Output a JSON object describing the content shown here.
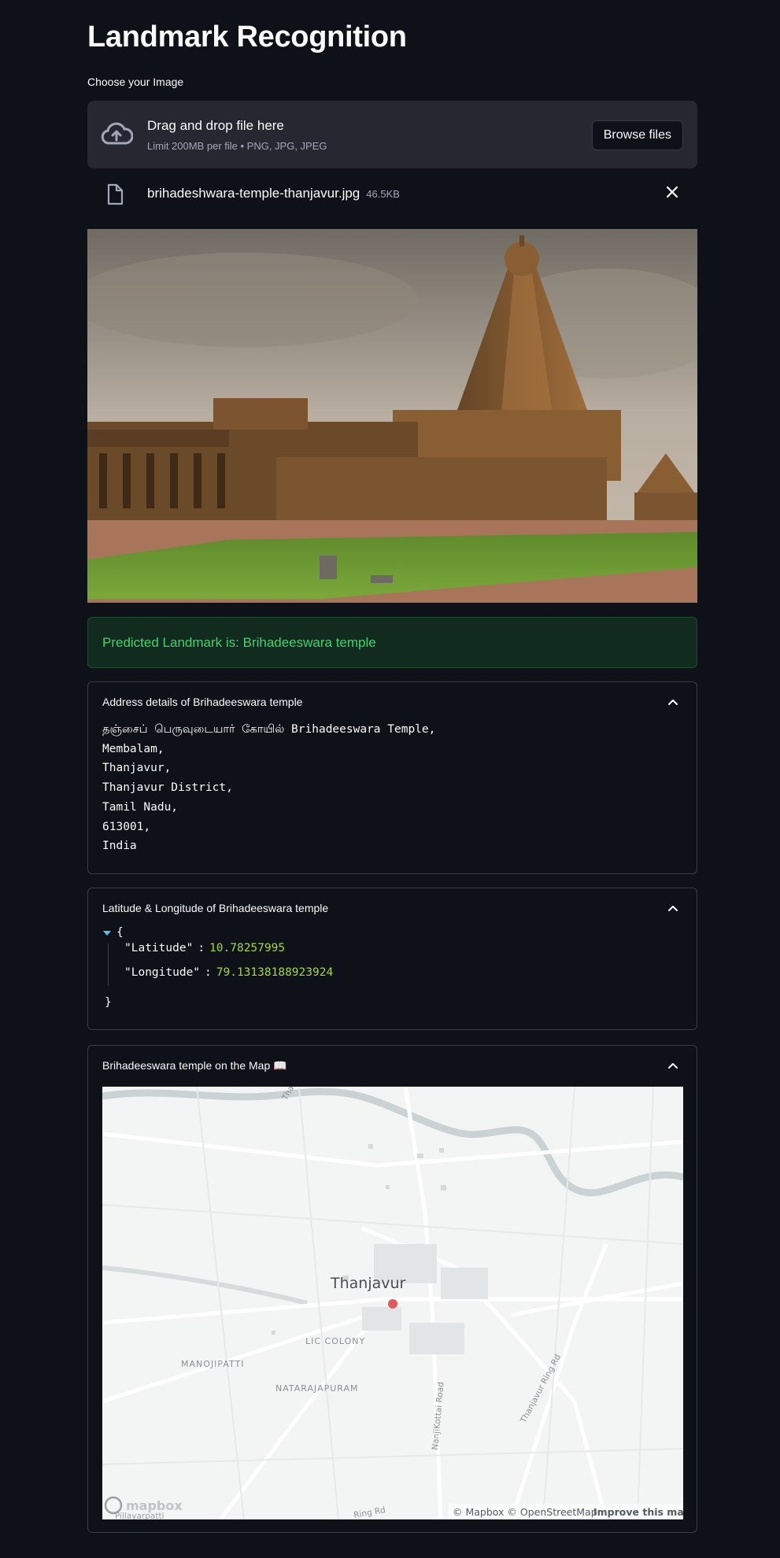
{
  "header": {
    "title": "Landmark Recognition"
  },
  "uploader": {
    "label": "Choose your Image",
    "drop_title": "Drag and drop file here",
    "drop_subtitle": "Limit 200MB per file • PNG, JPG, JPEG",
    "browse_label": "Browse files"
  },
  "file": {
    "name": "brihadeshwara-temple-thanjavur.jpg",
    "size": "46.5KB"
  },
  "prediction": {
    "text": "Predicted Landmark is: Brihadeeswara temple"
  },
  "address": {
    "title": "Address details of Brihadeeswara temple",
    "text": "தஞ்சைப் பெருவுடையார் கோயில் Brihadeeswara Temple,\nMembalam,\nThanjavur,\nThanjavur District,\nTamil Nadu,\n613001,\nIndia"
  },
  "coords": {
    "title": "Latitude & Longitude of Brihadeeswara temple",
    "open_brace": "{",
    "close_brace": "}",
    "colon": ":",
    "lat_key": "\"Latitude\"",
    "lat_value": "10.78257995",
    "lon_key": "\"Longitude\"",
    "lon_value": "79.13138188923924"
  },
  "map": {
    "title": "Brihadeeswara temple on the Map 📖",
    "city": "Thanjavur",
    "labels": {
      "lic_colony": "LIC COLONY",
      "manojipatti": "MANOJIPATTI",
      "natarajapuram": "NATARAJAPURAM",
      "nanji_road": "NanjiKottai Road",
      "ring_rd": "Thanjavur Ring Rd",
      "ring_rd_bottom": "Ring Rd",
      "thanj_top": "Thanj",
      "pillaiyarpatti": "Pillayarpatti"
    },
    "logo": "mapbox",
    "attribution": "© Mapbox © OpenStreetMap",
    "improve": "Improve this map"
  },
  "colors": {
    "background": "#0e1117",
    "success_text": "#3dd56d",
    "json_number": "#a4d937",
    "marker": "#e05a5a"
  }
}
